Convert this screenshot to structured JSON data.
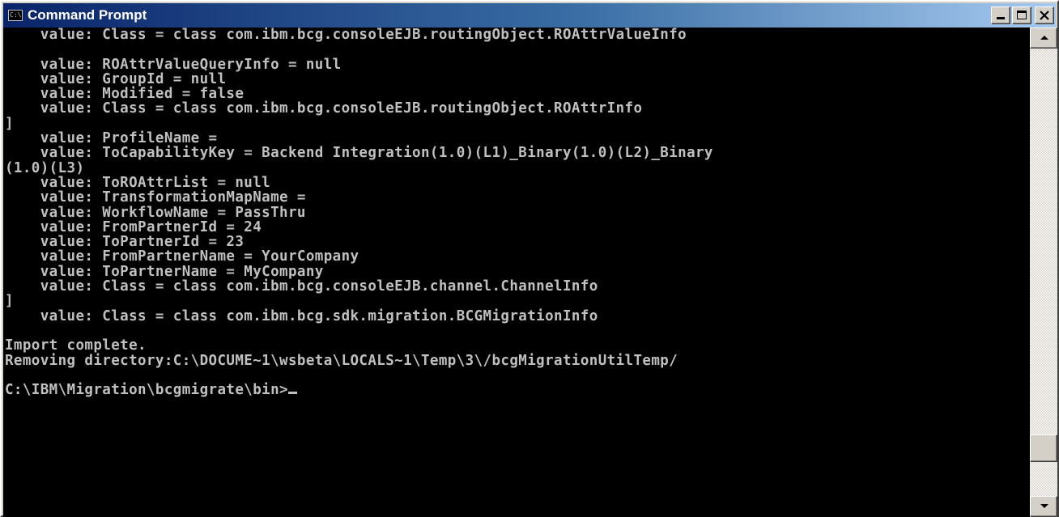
{
  "window": {
    "title": "Command Prompt",
    "icon_label": "C:\\",
    "controls": {
      "minimize": "minimize-icon",
      "maximize": "maximize-icon",
      "close": "close-icon"
    }
  },
  "colors": {
    "titlebar_start": "#0a246a",
    "titlebar_end": "#a6caf0",
    "console_bg": "#000000",
    "console_text": "#c0c0c0"
  },
  "console": {
    "lines": [
      "    value: Class = class com.ibm.bcg.consoleEJB.routingObject.ROAttrValueInfo",
      "",
      "    value: ROAttrValueQueryInfo = null",
      "    value: GroupId = null",
      "    value: Modified = false",
      "    value: Class = class com.ibm.bcg.consoleEJB.routingObject.ROAttrInfo",
      "]",
      "    value: ProfileName =",
      "    value: ToCapabilityKey = Backend Integration(1.0)(L1)_Binary(1.0)(L2)_Binary",
      "(1.0)(L3)",
      "    value: ToROAttrList = null",
      "    value: TransformationMapName =",
      "    value: WorkflowName = PassThru",
      "    value: FromPartnerId = 24",
      "    value: ToPartnerId = 23",
      "    value: FromPartnerName = YourCompany",
      "    value: ToPartnerName = MyCompany",
      "    value: Class = class com.ibm.bcg.consoleEJB.channel.ChannelInfo",
      "]",
      "    value: Class = class com.ibm.bcg.sdk.migration.BCGMigrationInfo",
      "",
      "Import complete.",
      "Removing directory:C:\\DOCUME~1\\wsbeta\\LOCALS~1\\Temp\\3\\/bcgMigrationUtilTemp/",
      "",
      "C:\\IBM\\Migration\\bcgmigrate\\bin>"
    ]
  },
  "scrollbar": {
    "position": 0.92
  }
}
